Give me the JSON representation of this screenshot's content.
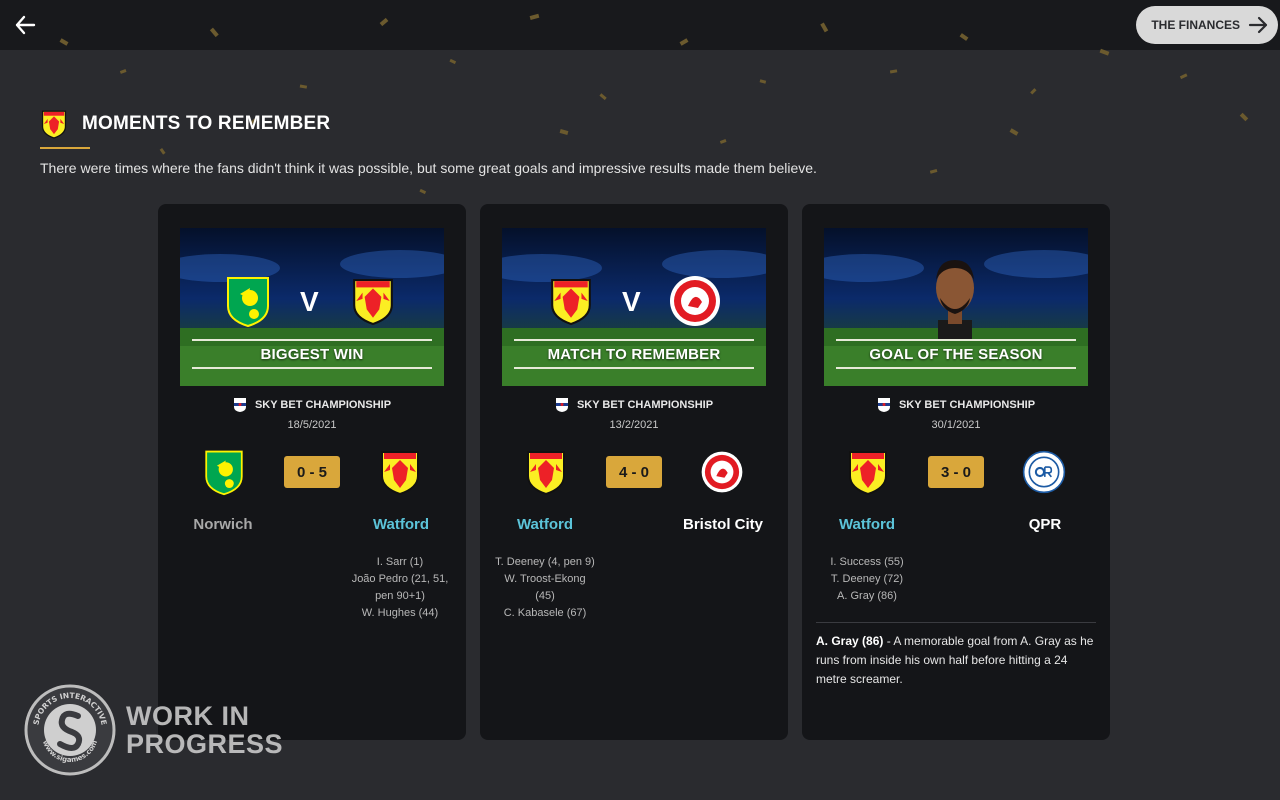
{
  "topbar": {
    "back_icon": "arrow-left-icon",
    "next_label": "THE FINANCES",
    "next_icon": "arrow-right-icon"
  },
  "section": {
    "title": "MOMENTS TO REMEMBER",
    "intro": "There were times where the fans didn't think it was possible, but some great goals and impressive results made them believe.",
    "accent": "#d9a73b"
  },
  "cards": [
    {
      "banner_label": "BIGGEST WIN",
      "banner_v": "V",
      "competition": "SKY BET CHAMPIONSHIP",
      "date": "18/5/2021",
      "score": "0 - 5",
      "home": "Norwich",
      "away": "Watford",
      "home_scorers": [],
      "away_scorers": [
        "I. Sarr (1)",
        "João Pedro (21, 51, pen 90+1)",
        "W. Hughes (44)"
      ]
    },
    {
      "banner_label": "MATCH TO REMEMBER",
      "banner_v": "V",
      "competition": "SKY BET CHAMPIONSHIP",
      "date": "13/2/2021",
      "score": "4 - 0",
      "home": "Watford",
      "away": "Bristol City",
      "home_scorers": [
        "T. Deeney (4, pen 9)",
        "W. Troost-Ekong (45)",
        "C. Kabasele (67)"
      ],
      "away_scorers": []
    },
    {
      "banner_label": "GOAL OF THE SEASON",
      "competition": "SKY BET CHAMPIONSHIP",
      "date": "30/1/2021",
      "score": "3 - 0",
      "home": "Watford",
      "away": "QPR",
      "home_scorers": [
        "I. Success (55)",
        "T. Deeney (72)",
        "A. Gray (86)"
      ],
      "away_scorers": [],
      "desc_bold": "A. Gray (86)",
      "desc_rest": " - A memorable goal from A. Gray as he runs from inside his own half before hitting a 24 metre screamer."
    }
  ],
  "watermark": {
    "line1": "WORK IN",
    "line2": "PROGRESS",
    "ring_top": "SPORTS INTERACTIVE",
    "ring_bottom": "www.sigames.com"
  },
  "colors": {
    "watford_yellow": "#fbee23",
    "watford_red": "#ed2127",
    "norwich_green": "#00a650",
    "norwich_yellow": "#fff200",
    "bristol_red": "#e21b23",
    "qpr_blue": "#1d5ba4",
    "highlight_team": "#5cc4d9"
  }
}
